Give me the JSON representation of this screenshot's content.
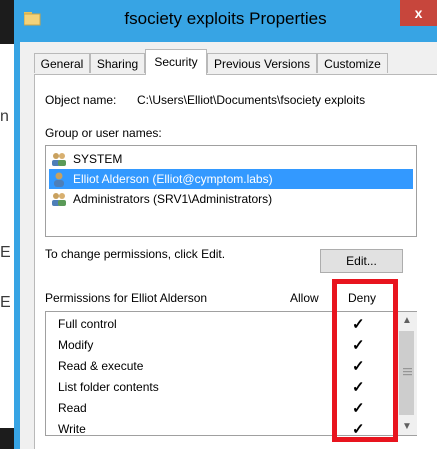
{
  "window": {
    "title": "fsociety exploits Properties",
    "close_label": "x"
  },
  "background_fragments": [
    "n",
    "E",
    "E"
  ],
  "tabs": [
    {
      "label": "General"
    },
    {
      "label": "Sharing"
    },
    {
      "label": "Security"
    },
    {
      "label": "Previous Versions"
    },
    {
      "label": "Customize"
    }
  ],
  "security": {
    "object_name_label": "Object name:",
    "object_name_value": "C:\\Users\\Elliot\\Documents\\fsociety exploits",
    "group_label": "Group or user names:",
    "users": [
      {
        "name": "SYSTEM",
        "icon": "users-group-icon",
        "selected": false
      },
      {
        "name": "Elliot Alderson (Elliot@cymptom.labs)",
        "icon": "user-icon",
        "selected": true
      },
      {
        "name": "Administrators (SRV1\\Administrators)",
        "icon": "users-group-icon",
        "selected": false
      }
    ],
    "change_text": "To change permissions, click Edit.",
    "edit_label": "Edit...",
    "permissions_label": "Permissions for Elliot Alderson",
    "allow_header": "Allow",
    "deny_header": "Deny",
    "permissions": [
      {
        "name": "Full control",
        "allow": "",
        "deny": "✓"
      },
      {
        "name": "Modify",
        "allow": "",
        "deny": "✓"
      },
      {
        "name": "Read & execute",
        "allow": "",
        "deny": "✓"
      },
      {
        "name": "List folder contents",
        "allow": "",
        "deny": "✓"
      },
      {
        "name": "Read",
        "allow": "",
        "deny": "✓"
      },
      {
        "name": "Write",
        "allow": "",
        "deny": "✓"
      }
    ]
  },
  "colors": {
    "titlebar": "#37a4e4",
    "selection": "#3399ff",
    "highlight_box": "#e8141e",
    "close_button": "#c7463c"
  }
}
